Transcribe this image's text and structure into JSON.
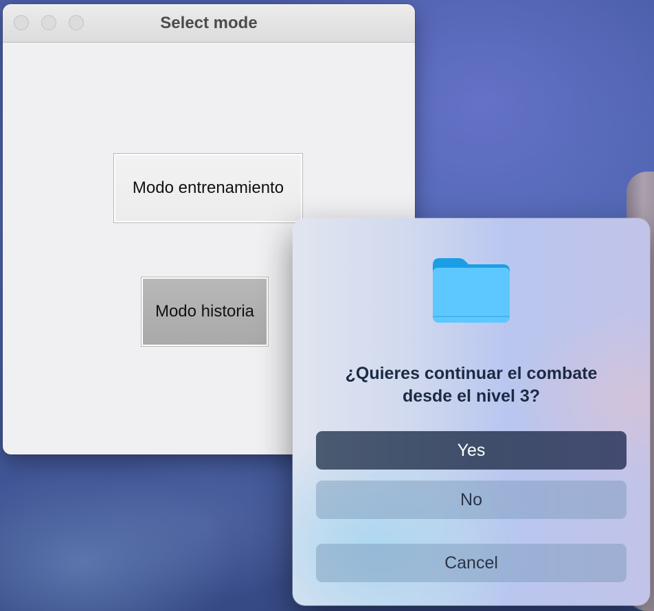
{
  "window": {
    "title": "Select mode",
    "buttons": {
      "training": "Modo entrenamiento",
      "story": "Modo historia"
    }
  },
  "alert": {
    "icon": "folder-icon",
    "message_line1": "¿Quieres continuar el combate",
    "message_line2": "desde el nivel 3?",
    "buttons": {
      "yes": "Yes",
      "no": "No",
      "cancel": "Cancel"
    }
  },
  "colors": {
    "primary_button": "#3f4d6a",
    "folder_blue": "#5cc8ff"
  }
}
